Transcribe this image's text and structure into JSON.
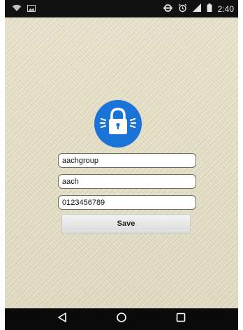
{
  "status_bar": {
    "time": "2:40",
    "icons": [
      "wifi-icon",
      "image-icon",
      "data-saver-icon",
      "alarm-icon",
      "signal-icon",
      "battery-icon"
    ]
  },
  "app": {
    "lock_icon": "padlock-icon",
    "accent_color": "#1a74d8",
    "fields": {
      "username_value": "aachgroup",
      "password_value": "aach",
      "phone_value": "0123456789"
    },
    "save_label": "Save"
  },
  "nav_bar": {
    "icons": [
      "back-icon",
      "home-icon",
      "recents-icon"
    ]
  }
}
